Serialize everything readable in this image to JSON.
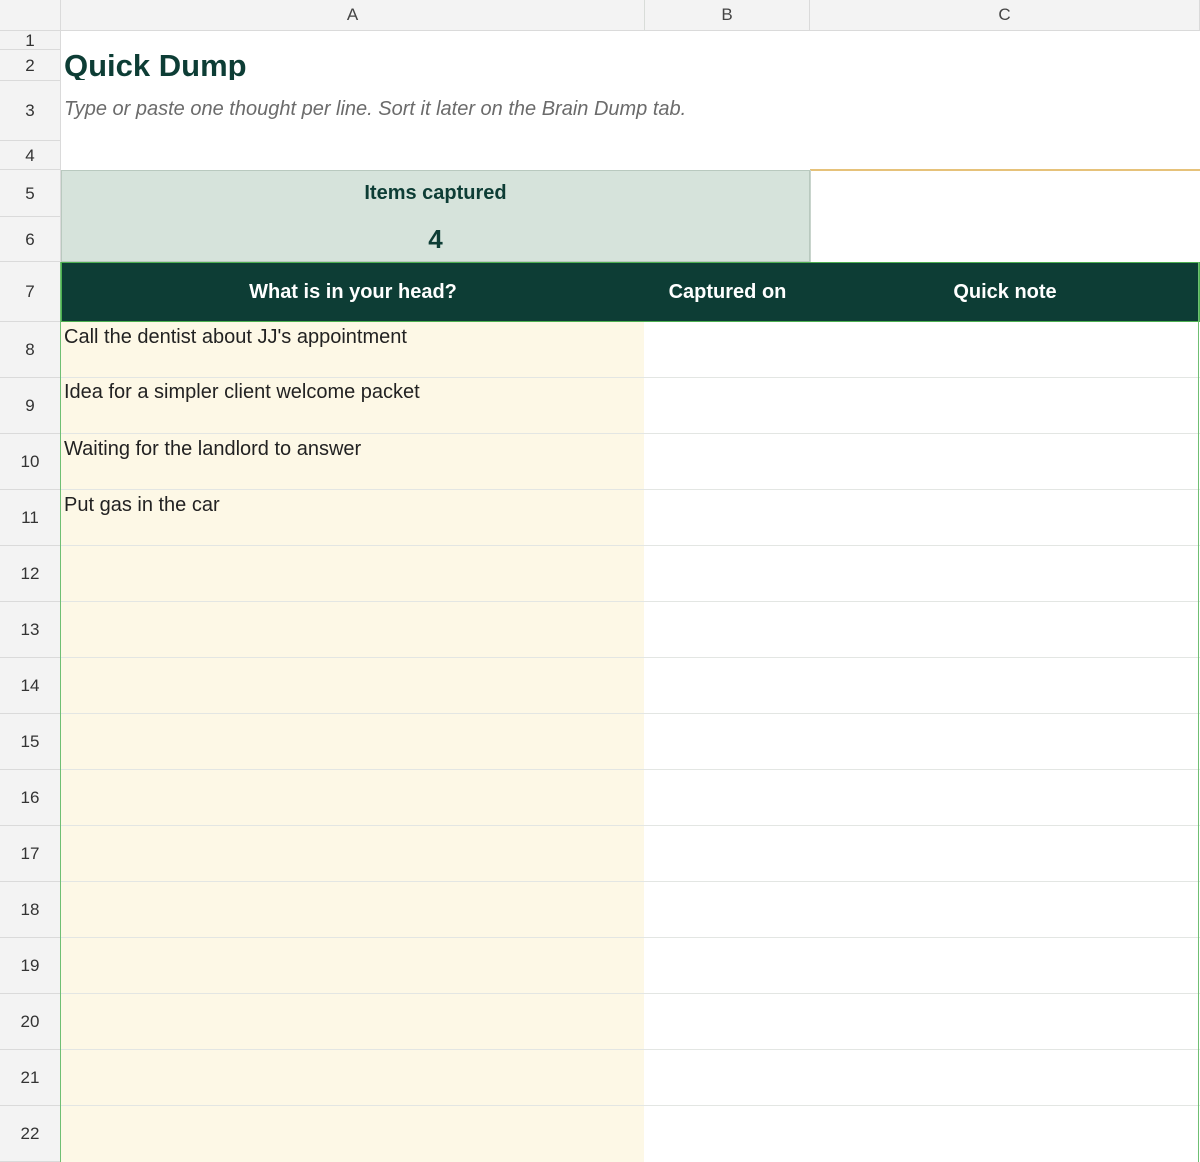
{
  "columns": [
    "A",
    "B",
    "C"
  ],
  "rows": [
    "1",
    "2",
    "3",
    "4",
    "5",
    "6",
    "7",
    "8",
    "9",
    "10",
    "11",
    "12",
    "13",
    "14",
    "15",
    "16",
    "17",
    "18",
    "19",
    "20",
    "21",
    "22"
  ],
  "sheet": {
    "title": "Quick Dump",
    "subtitle": "Type or paste one thought per line. Sort it later on the Brain Dump tab.",
    "summary": {
      "label": "Items captured",
      "value": "4"
    },
    "table": {
      "headers": [
        "What is in your head?",
        "Captured on",
        "Quick note"
      ],
      "items": [
        "Call the dentist about JJ's appointment",
        "Idea for a simpler client welcome packet",
        "Waiting for the landlord to answer",
        "Put gas in the car"
      ]
    }
  },
  "colors": {
    "header_bg": "#0d3d35",
    "title": "#0d3d35",
    "summary_bg": "#d6e3db",
    "input_fill": "#fdf8e6",
    "accent_line": "#e6c27a"
  }
}
